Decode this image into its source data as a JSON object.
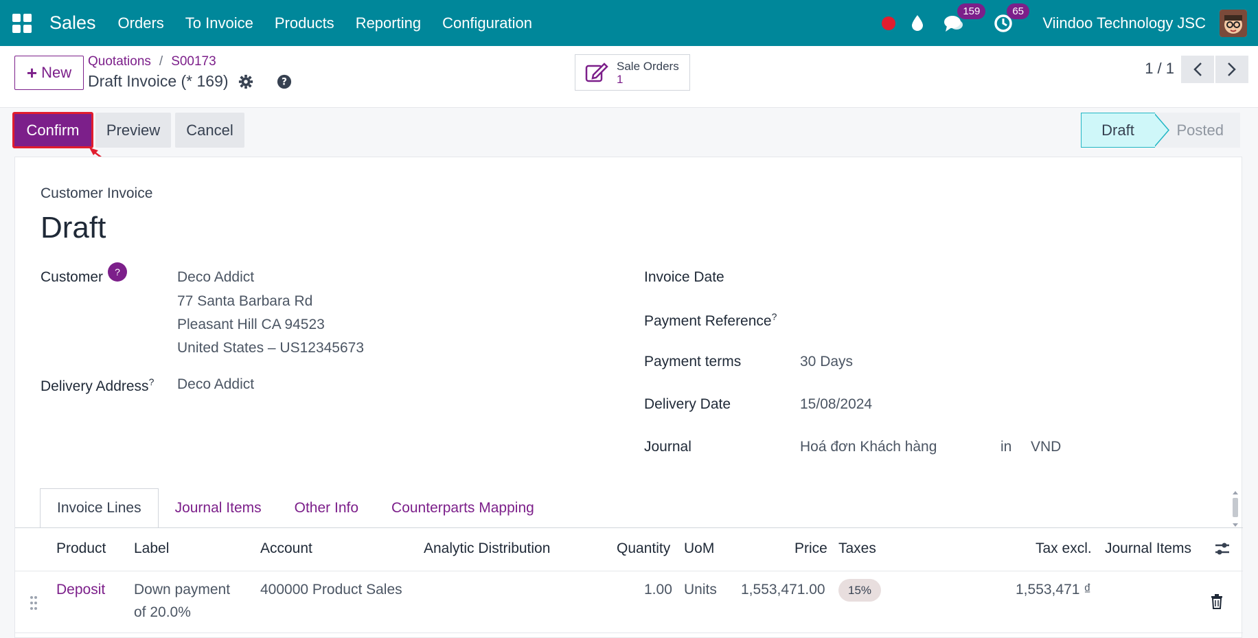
{
  "topbar": {
    "brand": "Sales",
    "menu": [
      "Orders",
      "To Invoice",
      "Products",
      "Reporting",
      "Configuration"
    ],
    "messages_count": "159",
    "activities_count": "65",
    "company": "Viindoo Technology JSC"
  },
  "control": {
    "new_label": "New",
    "breadcrumb": [
      "Quotations",
      "S00173"
    ],
    "breadcrumb_sep": "/",
    "title": "Draft Invoice (* 169)",
    "smart_button": {
      "label": "Sale Orders",
      "count": "1"
    },
    "pager": "1 / 1"
  },
  "actions": {
    "confirm": "Confirm",
    "preview": "Preview",
    "cancel": "Cancel"
  },
  "status": {
    "stages": [
      "Draft",
      "Posted"
    ],
    "current": "Draft"
  },
  "form": {
    "type_label": "Customer Invoice",
    "name": "Draft",
    "customer_label": "Customer",
    "customer_help": "?",
    "customer_lines": [
      "Deco Addict",
      "77 Santa Barbara Rd",
      "Pleasant Hill CA 94523",
      "United States – US12345673"
    ],
    "delivery_address_label": "Delivery Address",
    "delivery_address": "Deco Addict",
    "invoice_date_label": "Invoice Date",
    "payment_ref_label": "Payment Reference",
    "payment_terms_label": "Payment terms",
    "payment_terms": "30 Days",
    "delivery_date_label": "Delivery Date",
    "delivery_date": "15/08/2024",
    "journal_label": "Journal",
    "journal": "Hoá đơn Khách hàng",
    "journal_in": "in",
    "currency": "VND",
    "tooltip_mark": "?"
  },
  "tabs": [
    "Invoice Lines",
    "Journal Items",
    "Other Info",
    "Counterparts Mapping"
  ],
  "table": {
    "headers": [
      "Product",
      "Label",
      "Account",
      "Analytic Distribution",
      "Quantity",
      "UoM",
      "Price",
      "Taxes",
      "Tax excl.",
      "Journal Items"
    ],
    "rows": [
      {
        "product": "Deposit",
        "label_1": "Down payment",
        "label_2": "of 20.0%",
        "account": "400000 Product Sales",
        "quantity": "1.00",
        "uom": "Units",
        "price": "1,553,471.00",
        "tax": "15%",
        "tax_excl": "1,553,471 ₫"
      }
    ]
  },
  "colors": {
    "topbar": "#00879a",
    "brand_purple": "#7c1f8a",
    "highlight_red": "#e11d2e",
    "draft_stage": "#cff7f9"
  }
}
